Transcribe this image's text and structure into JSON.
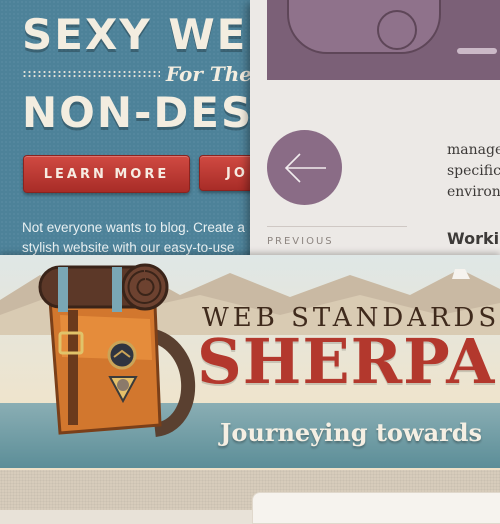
{
  "hero": {
    "line1": "SEXY WEB",
    "for_the": "For The",
    "line2": "NON-DESIG",
    "learn_more": "LEARN MORE",
    "join": "JO",
    "copy": "Not everyone wants to blog. Create a stylish website with our easy-to-use"
  },
  "blog": {
    "prev_label": "PREVIOUS",
    "text_lines": [
      "manage",
      "specific",
      "environ"
    ],
    "heading": "Workin"
  },
  "sherpa": {
    "title_small": "WEB STANDARDS",
    "title_big": "SHERPA",
    "tagline": "Journeying towards"
  },
  "colors": {
    "hero_bg": "#4d8299",
    "button_red": "#b9352f",
    "prev_circle": "#8a6c86",
    "sherpa_red": "#b3382d"
  },
  "icons": [
    "arrow-left-icon",
    "backpack-illustration",
    "mountain-illustration"
  ]
}
